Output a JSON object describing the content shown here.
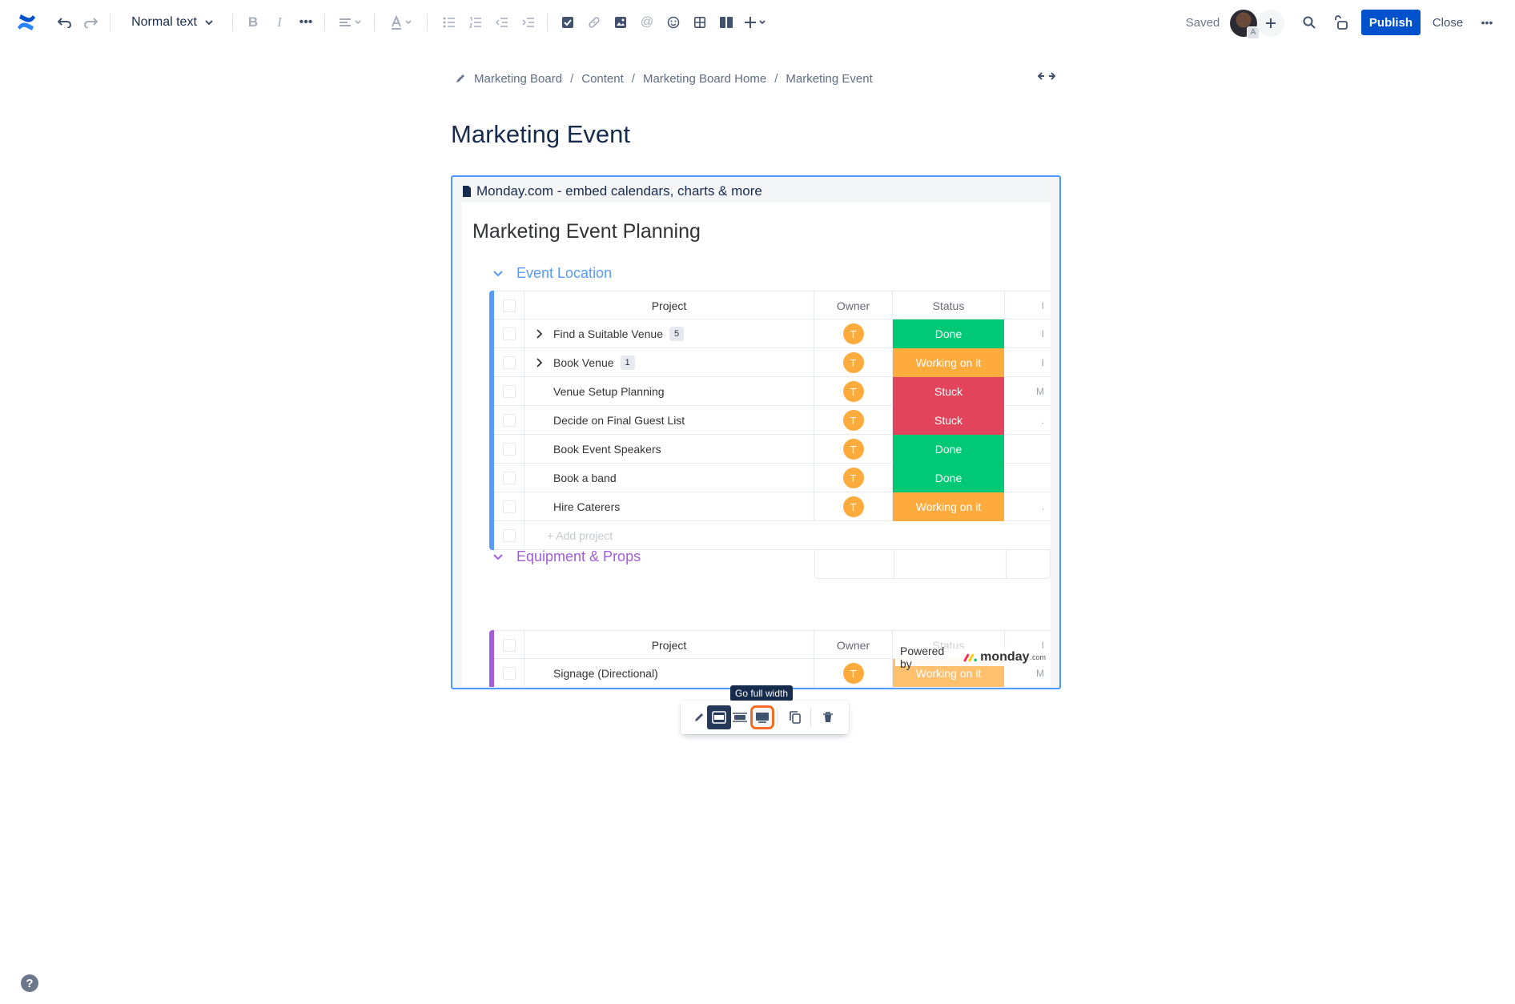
{
  "toolbar": {
    "text_style": "Normal text",
    "saved_label": "Saved",
    "avatar_badge": "A",
    "publish_label": "Publish",
    "close_label": "Close"
  },
  "breadcrumb": {
    "items": [
      "Marketing Board",
      "Content",
      "Marketing Board Home",
      "Marketing Event"
    ]
  },
  "page": {
    "title": "Marketing Event"
  },
  "embed": {
    "header": "Monday.com - embed calendars, charts & more",
    "board_title": "Marketing Event Planning",
    "powered_by": "Powered by",
    "brand": "monday",
    "brand_suffix": ".com",
    "columns": {
      "project": "Project",
      "owner": "Owner",
      "status": "Status"
    },
    "groups": [
      {
        "name": "Event Location",
        "color": "#579bfc",
        "rows": [
          {
            "project": "Find a Suitable Venue",
            "subitems": "5",
            "owner": "T",
            "status": "Done",
            "more": "I"
          },
          {
            "project": "Book Venue",
            "subitems": "1",
            "owner": "T",
            "status": "Working on it",
            "more": "I"
          },
          {
            "project": "Venue Setup Planning",
            "owner": "T",
            "status": "Stuck",
            "more": "M"
          },
          {
            "project": "Decide on Final Guest List",
            "owner": "T",
            "status": "Stuck",
            "more": "."
          },
          {
            "project": "Book Event Speakers",
            "owner": "T",
            "status": "Done",
            "more": ""
          },
          {
            "project": "Book a band",
            "owner": "T",
            "status": "Done",
            "more": ""
          },
          {
            "project": "Hire Caterers",
            "owner": "T",
            "status": "Working on it",
            "more": "."
          }
        ],
        "add_placeholder": "+ Add project"
      },
      {
        "name": "Equipment & Props",
        "color": "#a25ddc",
        "rows": [
          {
            "project": "Signage (Directional)",
            "owner": "T",
            "status": "Working on it",
            "more": "M"
          }
        ]
      }
    ]
  },
  "float_toolbar": {
    "tooltip": "Go full width"
  },
  "colors": {
    "accent": "#0052cc",
    "done": "#00c875",
    "working": "#fdab3d",
    "stuck": "#e2445c",
    "highlight": "#f26c22"
  }
}
